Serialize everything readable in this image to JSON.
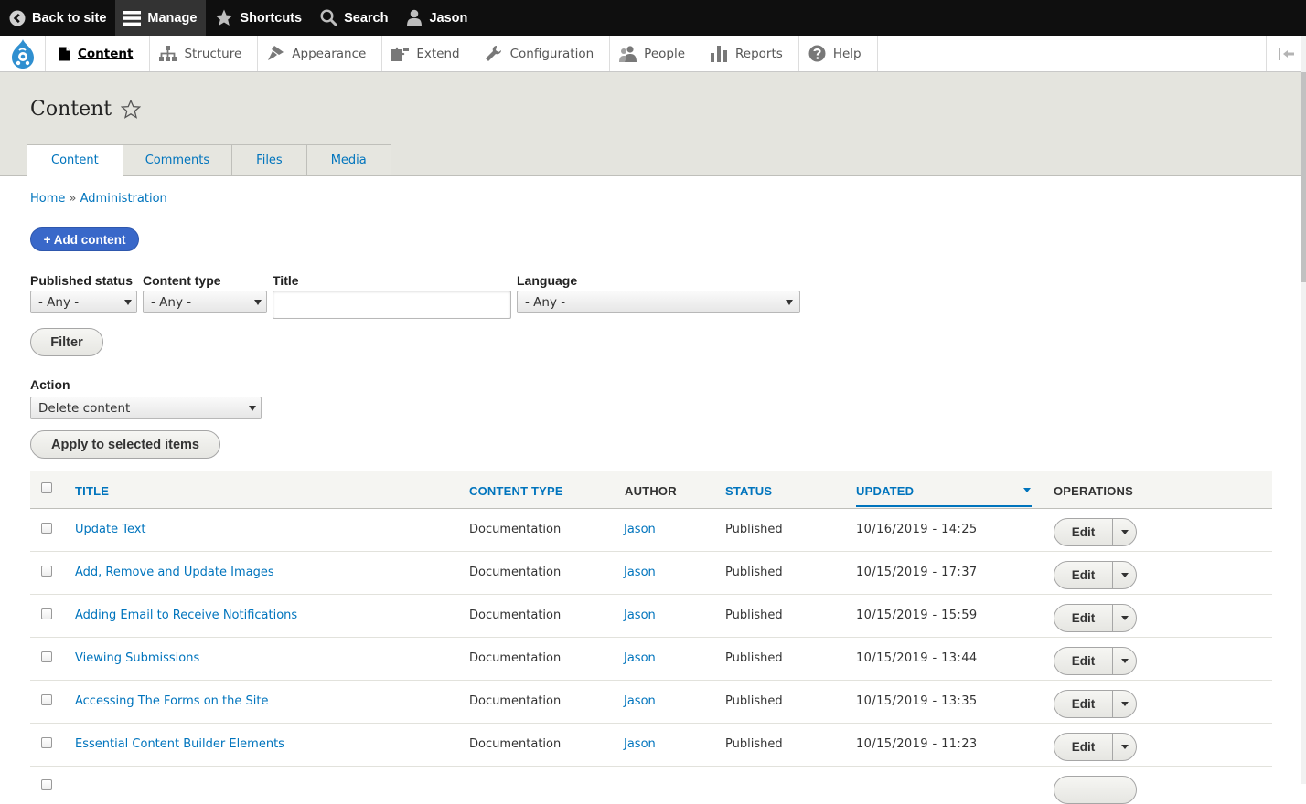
{
  "toolbar": {
    "back_label": "Back to site",
    "manage_label": "Manage",
    "shortcuts_label": "Shortcuts",
    "search_label": "Search",
    "user_label": "Jason"
  },
  "tray": {
    "items": [
      {
        "label": "Content",
        "icon": "page-icon"
      },
      {
        "label": "Structure",
        "icon": "structure-icon"
      },
      {
        "label": "Appearance",
        "icon": "brush-icon"
      },
      {
        "label": "Extend",
        "icon": "puzzle-icon"
      },
      {
        "label": "Configuration",
        "icon": "wrench-icon"
      },
      {
        "label": "People",
        "icon": "people-icon"
      },
      {
        "label": "Reports",
        "icon": "bar-chart-icon"
      },
      {
        "label": "Help",
        "icon": "help-icon"
      }
    ]
  },
  "header": {
    "title": "Content",
    "tabs": [
      "Content",
      "Comments",
      "Files",
      "Media"
    ]
  },
  "breadcrumb": {
    "home": "Home",
    "separator": "»",
    "admin": "Administration"
  },
  "add_content_label": "+ Add content",
  "filters": {
    "published_status": {
      "label": "Published status",
      "value": "- Any -"
    },
    "content_type": {
      "label": "Content type",
      "value": "- Any -"
    },
    "title": {
      "label": "Title",
      "value": ""
    },
    "language": {
      "label": "Language",
      "value": "- Any -"
    },
    "filter_button": "Filter"
  },
  "action": {
    "label": "Action",
    "value": "Delete content",
    "apply_button": "Apply to selected items"
  },
  "table": {
    "headers": {
      "title": "TITLE",
      "content_type": "CONTENT TYPE",
      "author": "AUTHOR",
      "status": "STATUS",
      "updated": "UPDATED",
      "operations": "OPERATIONS"
    },
    "rows": [
      {
        "title": "Update Text",
        "type": "Documentation",
        "author": "Jason",
        "status": "Published",
        "updated": "10/16/2019 - 14:25",
        "op": "Edit"
      },
      {
        "title": "Add, Remove and Update Images",
        "type": "Documentation",
        "author": "Jason",
        "status": "Published",
        "updated": "10/15/2019 - 17:37",
        "op": "Edit"
      },
      {
        "title": "Adding Email to Receive Notifications",
        "type": "Documentation",
        "author": "Jason",
        "status": "Published",
        "updated": "10/15/2019 - 15:59",
        "op": "Edit"
      },
      {
        "title": "Viewing Submissions",
        "type": "Documentation",
        "author": "Jason",
        "status": "Published",
        "updated": "10/15/2019 - 13:44",
        "op": "Edit"
      },
      {
        "title": "Accessing The Forms on the Site",
        "type": "Documentation",
        "author": "Jason",
        "status": "Published",
        "updated": "10/15/2019 - 13:35",
        "op": "Edit"
      },
      {
        "title": "Essential Content Builder Elements",
        "type": "Documentation",
        "author": "Jason",
        "status": "Published",
        "updated": "10/15/2019 - 11:23",
        "op": "Edit"
      }
    ]
  },
  "colors": {
    "link": "#0074bd",
    "primary_button": "#3968c9",
    "toolbar": "#0f0f0f",
    "header_bg": "#e4e4de"
  }
}
